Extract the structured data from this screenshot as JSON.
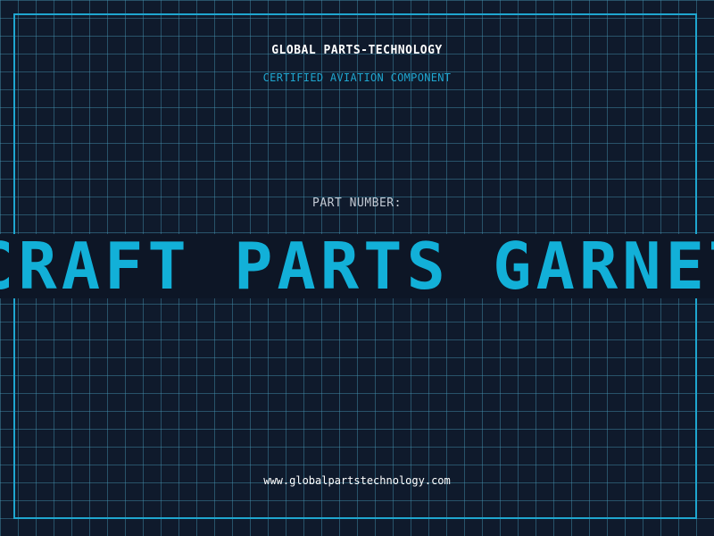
{
  "brand": {
    "name": "GLOBAL PARTS-TECHNOLOGY",
    "tagline": "CERTIFIED AVIATION COMPONENT"
  },
  "part": {
    "label": "PART NUMBER:",
    "value": "CRAFT PARTS GARNETT"
  },
  "footer": {
    "url": "www.globalpartstechnology.com"
  },
  "colors": {
    "background": "#0f1a2c",
    "accent": "#1fa6cf",
    "banner_text": "#12b0d8",
    "label": "#c3cad4",
    "white": "#ffffff"
  }
}
